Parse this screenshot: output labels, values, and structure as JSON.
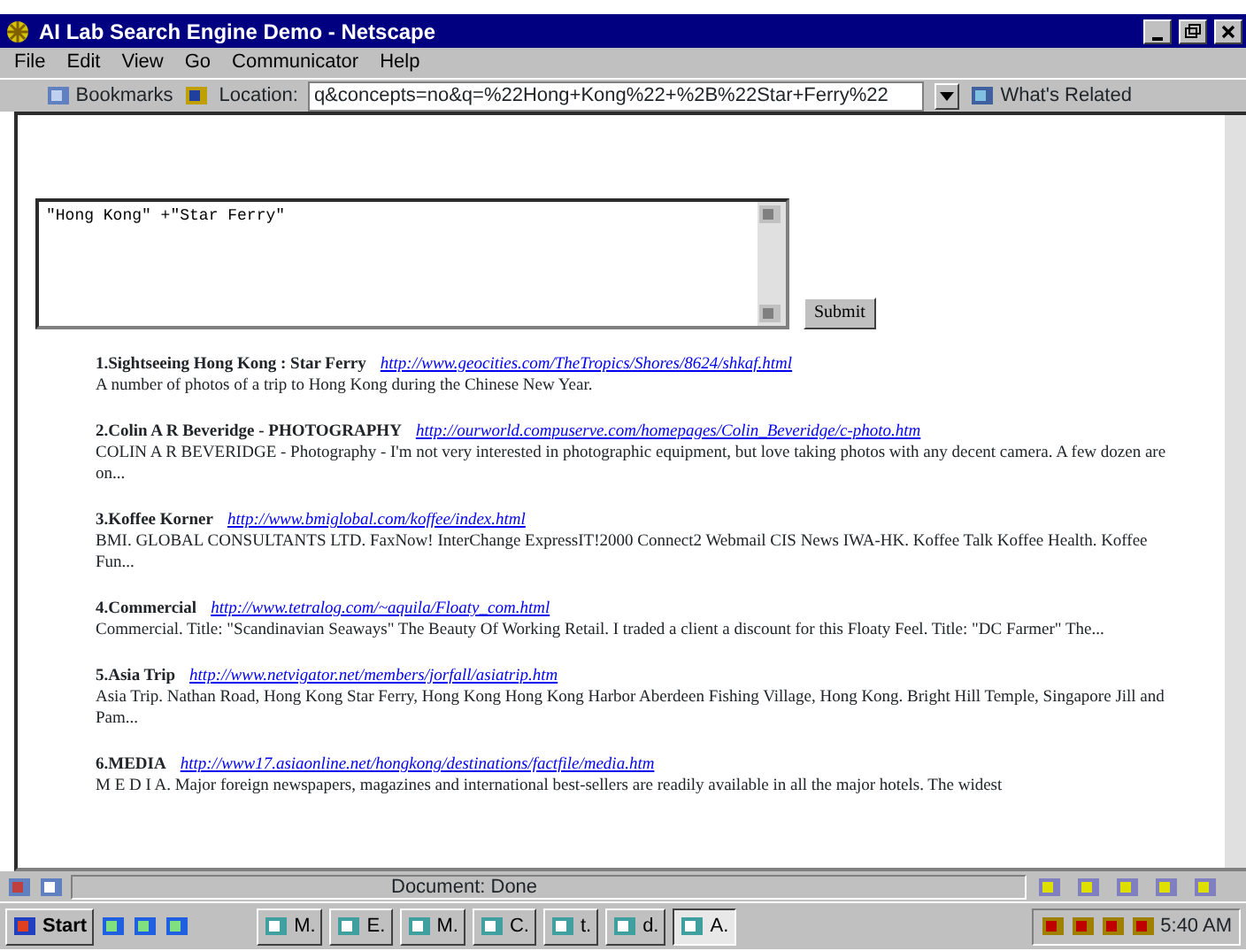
{
  "window": {
    "title": "AI Lab Search Engine Demo - Netscape"
  },
  "menu": [
    "File",
    "Edit",
    "View",
    "Go",
    "Communicator",
    "Help"
  ],
  "toolbar": {
    "bookmarks": "Bookmarks",
    "location_label": "Location:",
    "location": "q&concepts=no&q=%22Hong+Kong%22+%2B%22Star+Ferry%22",
    "related": "What's Related"
  },
  "query": {
    "value": "\"Hong Kong\" +\"Star Ferry\"",
    "submit": "Submit"
  },
  "results": [
    {
      "number": "1.",
      "title": "Sightseeing Hong Kong : Star Ferry",
      "url": "http://www.geocities.com/TheTropics/Shores/8624/shkaf.html",
      "description": "A number of photos of a trip to Hong Kong during the Chinese New Year."
    },
    {
      "number": "2.",
      "title": "Colin A R Beveridge - PHOTOGRAPHY",
      "url": "http://ourworld.compuserve.com/homepages/Colin_Beveridge/c-photo.htm",
      "description": "COLIN A R BEVERIDGE - Photography - I'm not very interested in photographic equipment, but love taking photos with any decent camera. A few dozen are on..."
    },
    {
      "number": "3.",
      "title": "Koffee Korner",
      "url": "http://www.bmiglobal.com/koffee/index.html",
      "description": "BMI. GLOBAL CONSULTANTS LTD. FaxNow! InterChange ExpressIT!2000 Connect2 Webmail CIS News IWA-HK. Koffee Talk Koffee Health. Koffee Fun..."
    },
    {
      "number": "4.",
      "title": "Commercial",
      "url": "http://www.tetralog.com/~aquila/Floaty_com.html",
      "description": "Commercial. Title: \"Scandinavian Seaways\" The Beauty Of Working Retail. I traded a client a discount for this Floaty Feel. Title: \"DC Farmer\" The..."
    },
    {
      "number": "5.",
      "title": "Asia Trip",
      "url": "http://www.netvigator.net/members/jorfall/asiatrip.htm",
      "description": "Asia Trip. Nathan Road, Hong Kong Star Ferry, Hong Kong Hong Kong Harbor Aberdeen Fishing Village, Hong Kong. Bright Hill Temple, Singapore Jill and Pam..."
    },
    {
      "number": "6.",
      "title": "MEDIA",
      "url": "http://www17.asiaonline.net/hongkong/destinations/factfile/media.htm",
      "description": "M E D I A. Major foreign newspapers, magazines and international best-sellers are readily available in all the major hotels. The widest"
    }
  ],
  "status_bar": {
    "text": "Document: Done"
  },
  "taskbar": {
    "start": "Start",
    "items": [
      {
        "label": "M.",
        "selected": false
      },
      {
        "label": "E.",
        "selected": false
      },
      {
        "label": "M.",
        "selected": false
      },
      {
        "label": "C.",
        "selected": false
      },
      {
        "label": "t.",
        "selected": false
      },
      {
        "label": "d.",
        "selected": false
      },
      {
        "label": "A.",
        "selected": true
      }
    ],
    "clock": "5:40 AM"
  }
}
